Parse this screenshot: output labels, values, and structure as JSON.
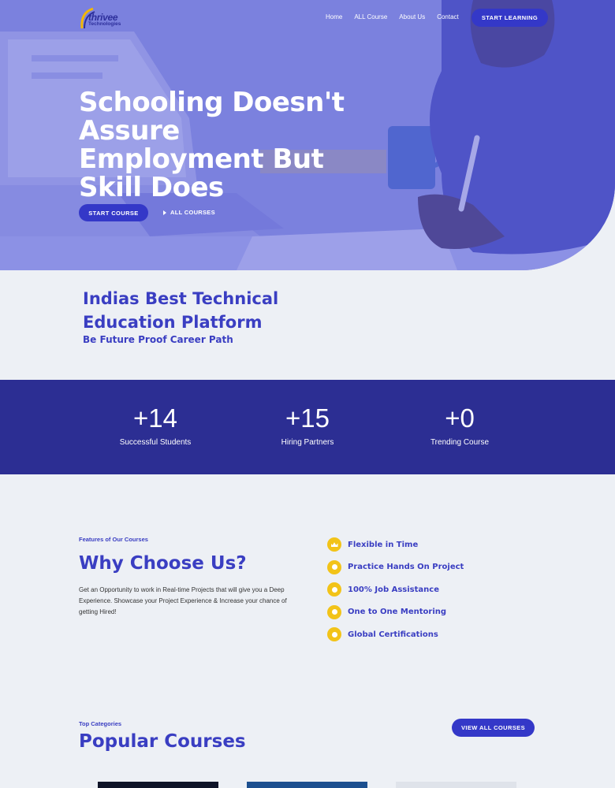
{
  "nav": {
    "logo": {
      "name": "thrivee",
      "subtitle": "Technologies"
    },
    "links": [
      "Home",
      "ALL Course",
      "About Us",
      "Contact"
    ],
    "cta": "START LEARNING"
  },
  "hero": {
    "title": "Schooling Doesn't Assure Employment But Skill Does",
    "primary_button": "START COURSE",
    "secondary_button": "ALL COURSES"
  },
  "platform": {
    "title": "Indias Best Technical Education Platform",
    "subtitle": "Be Future Proof Career Path"
  },
  "stats": [
    {
      "value": "+14",
      "label": "Successful Students"
    },
    {
      "value": "+15",
      "label": "Hiring Partners"
    },
    {
      "value": "+0",
      "label": "Trending Course"
    }
  ],
  "why": {
    "eyebrow": "Features of Our Courses",
    "title": "Why Choose Us?",
    "description": " Get an Opportunity to work in Real-time Projects that will give you a Deep Experience. Showcase your Project Experience & Increase your chance of getting Hired!",
    "features": [
      {
        "label": "Flexible in Time",
        "icon": "crown-icon"
      },
      {
        "label": "Practice Hands On Project",
        "icon": "clock-icon"
      },
      {
        "label": "100% Job Assistance",
        "icon": "badge-icon"
      },
      {
        "label": "One to One Mentoring",
        "icon": "badge-icon"
      },
      {
        "label": "Global Certifications",
        "icon": "badge-icon"
      }
    ]
  },
  "courses": {
    "eyebrow": "Top Categories",
    "title": "Popular Courses",
    "view_all": "VIEW ALL COURSES"
  },
  "colors": {
    "primary": "#3438c8",
    "heading": "#3a3ec2",
    "stats_bg": "#2c2e93",
    "feature_icon": "#f2c318"
  }
}
